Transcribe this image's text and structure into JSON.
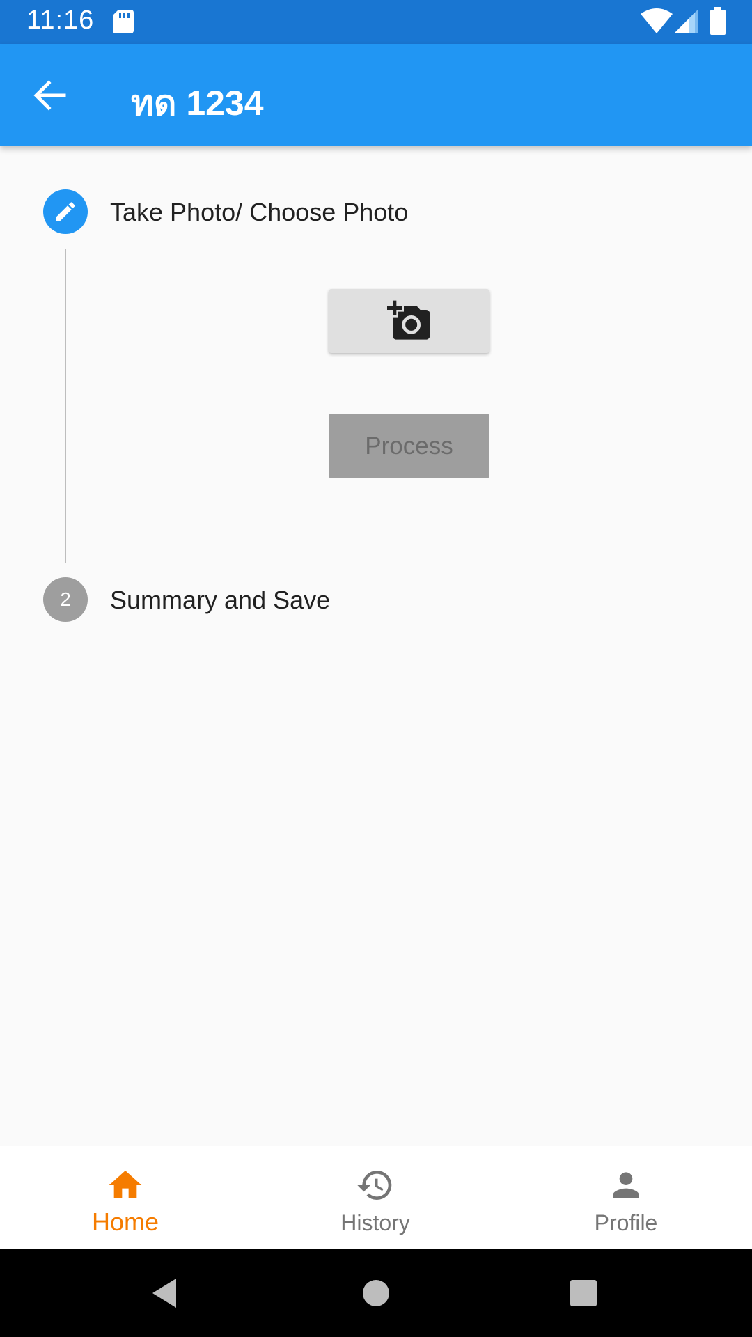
{
  "status_bar": {
    "time": "11:16",
    "icons": [
      "sd-card-icon",
      "wifi-icon",
      "signal-icon",
      "battery-icon"
    ]
  },
  "app_bar": {
    "title": "ทด 1234",
    "back_icon": "arrow-back-icon",
    "color": "#2196f3"
  },
  "stepper": {
    "steps": [
      {
        "title": "Take Photo/ Choose Photo",
        "icon": "edit-pencil-icon",
        "state": "editing"
      },
      {
        "number": "2",
        "title": "Summary and Save",
        "state": "pending"
      }
    ],
    "add_photo_icon": "add-a-photo-icon",
    "process_label": "Process"
  },
  "bottom_nav": {
    "items": [
      {
        "label": "Home",
        "icon": "home-icon",
        "active": true
      },
      {
        "label": "History",
        "icon": "history-icon",
        "active": false
      },
      {
        "label": "Profile",
        "icon": "person-icon",
        "active": false
      }
    ],
    "active_color": "#f57c00"
  },
  "system_nav": {
    "icons": [
      "back-triangle-icon",
      "home-circle-icon",
      "recents-square-icon"
    ]
  }
}
